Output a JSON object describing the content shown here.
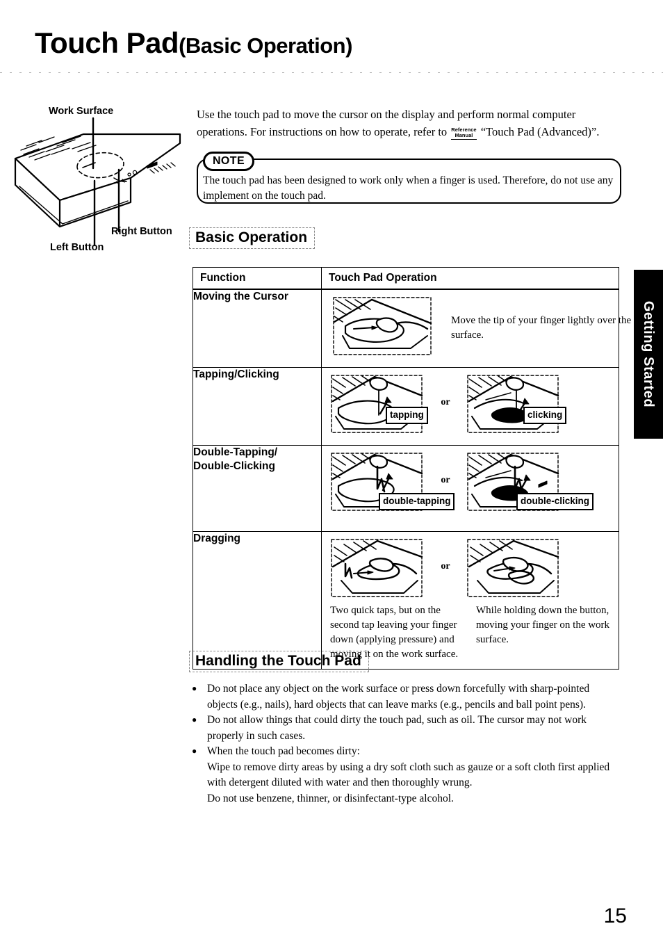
{
  "page": {
    "title_main": "Touch Pad",
    "title_sub": "(Basic Operation)",
    "number": "15",
    "side_tab": "Getting Started"
  },
  "figure": {
    "labels": {
      "work_surface": "Work Surface",
      "right_button": "Right Button",
      "left_button": "Left Button"
    }
  },
  "intro": {
    "line1": "Use the touch pad to move the cursor on the display and perform normal computer operations.",
    "line2_before": "For instructions on how to operate, refer to",
    "ref_icon_line1": "Reference",
    "ref_icon_line2": "Manual",
    "line2_after": "“Touch Pad (Advanced)”."
  },
  "note": {
    "label": "NOTE",
    "text": "The touch pad has been designed to work only when a finger is used.  Therefore, do not use any implement on the touch pad."
  },
  "sections": {
    "basic_operation": "Basic Operation",
    "handling": "Handling the Touch Pad"
  },
  "table": {
    "headers": {
      "function": "Function",
      "operation": "Touch Pad Operation"
    },
    "rows": [
      {
        "function": "Moving the Cursor",
        "caption": "Move the tip of your finger lightly over the surface.",
        "or_label": "",
        "callouts": []
      },
      {
        "function": "Tapping/Clicking",
        "or_label": "or",
        "callouts": [
          "tapping",
          "clicking"
        ]
      },
      {
        "function": "Double-Tapping/ Double-Clicking",
        "function_line1": "Double-Tapping/",
        "function_line2": "Double-Clicking",
        "or_label": "or",
        "callouts": [
          "double-tapping",
          "double-clicking"
        ]
      },
      {
        "function": "Dragging",
        "or_label": "or",
        "caption_left": "Two quick taps, but on the second tap leaving your finger down (applying pressure) and moving it on the work surface.",
        "caption_right": "While holding down the button, moving your finger on the work surface."
      }
    ]
  },
  "handling_bullets": [
    "Do not place any object on the work surface or press down forcefully with sharp-pointed objects (e.g., nails), hard objects that can leave marks (e.g., pencils and ball point pens).",
    "Do not allow things that could dirty the touch pad, such as oil.  The cursor may not work properly in such cases.",
    "When the touch pad becomes dirty:"
  ],
  "handling_sub_lines": [
    "Wipe to remove dirty areas by using a dry soft cloth such as gauze or a soft cloth first applied with detergent diluted with water and then thoroughly wrung.",
    "Do not use benzene, thinner, or disinfectant-type alcohol."
  ]
}
